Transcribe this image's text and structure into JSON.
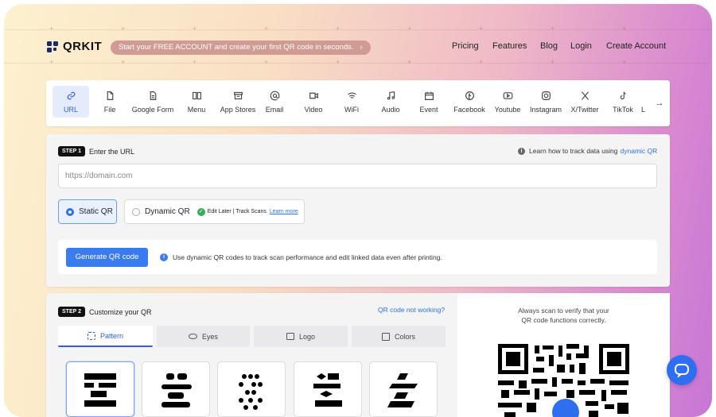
{
  "brand": {
    "name": "QRKIT"
  },
  "promo": {
    "text": "Start your FREE ACCOUNT and create your first QR code in seconds.",
    "arrow": "›"
  },
  "nav": [
    "Pricing",
    "Features",
    "Blog",
    "Login",
    "Create Account"
  ],
  "types": [
    {
      "label": "URL",
      "icon": "link-icon"
    },
    {
      "label": "File",
      "icon": "file-icon"
    },
    {
      "label": "Google Form",
      "icon": "form-icon"
    },
    {
      "label": "Menu",
      "icon": "book-icon"
    },
    {
      "label": "App Stores",
      "icon": "store-icon"
    },
    {
      "label": "Email",
      "icon": "at-icon"
    },
    {
      "label": "Video",
      "icon": "video-icon"
    },
    {
      "label": "WiFi",
      "icon": "wifi-icon"
    },
    {
      "label": "Audio",
      "icon": "music-icon"
    },
    {
      "label": "Event",
      "icon": "calendar-icon"
    },
    {
      "label": "Facebook",
      "icon": "facebook-icon"
    },
    {
      "label": "Youtube",
      "icon": "youtube-icon"
    },
    {
      "label": "Instagram",
      "icon": "instagram-icon"
    },
    {
      "label": "X/Twitter",
      "icon": "x-icon"
    },
    {
      "label": "TikTok",
      "icon": "tiktok-icon"
    },
    {
      "label": "L",
      "icon": "more-icon"
    }
  ],
  "step1": {
    "badge": "STEP 1",
    "label": "Enter the URL",
    "help_text": "Learn how to track data using",
    "help_link": "dynamic QR",
    "placeholder": "https://domain.com"
  },
  "options": {
    "static": "Static QR",
    "dynamic": "Dynamic QR",
    "dyn_note": "Edit Later | Track Scans",
    "learn": "Learn more"
  },
  "generate": {
    "button": "Generate QR code",
    "info": "Use dynamic QR codes to track scan performance and edit linked data even after printing."
  },
  "step2": {
    "badge": "STEP 2",
    "label": "Customize your QR",
    "not_working": "QR code not working?"
  },
  "tabs": [
    "Pattern",
    "Eyes",
    "Logo",
    "Colors"
  ],
  "preview": {
    "note_line1": "Always scan to verify that your",
    "note_line2": "QR code functions correctly."
  },
  "colors": {
    "accent": "#2f6fef",
    "button": "#3b7bf0"
  }
}
